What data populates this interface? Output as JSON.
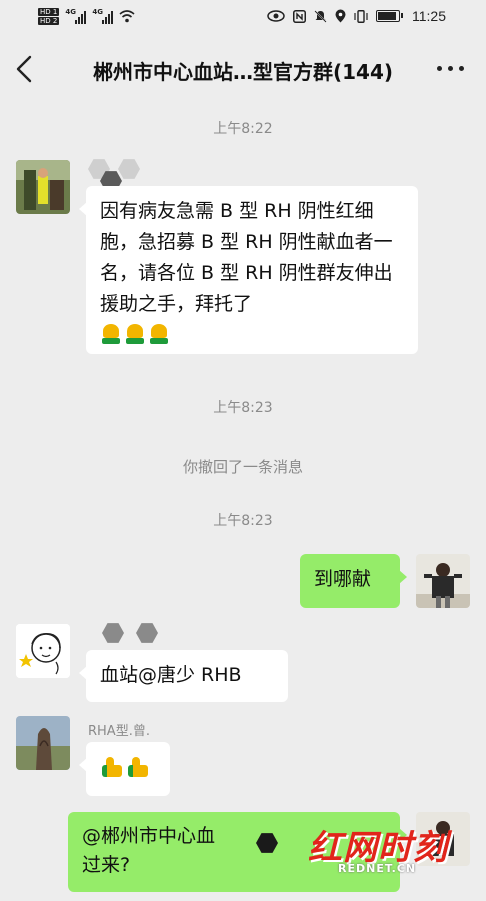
{
  "status_bar": {
    "time": "11:25",
    "network_1": "4G",
    "network_2": "4G",
    "hd_1": "HD 1",
    "hd_2": "HD 2"
  },
  "header": {
    "title": "郴州市中心血站…型官方群(144)",
    "back_icon": "chevron-left-icon",
    "more_icon": "more-dots-icon"
  },
  "messages": {
    "ts1": "上午8:22",
    "m1_text": "因有病友急需 B 型 RH 阴性红细胞，急招募 B 型 RH 阴性献血者一名，请各位 B 型 RH 阴性群友伸出援助之手，拜托了",
    "ts2": "上午8:23",
    "recall": "你撤回了一条消息",
    "ts3": "上午8:23",
    "m2_text": "到哪献",
    "m3_text": "血站@唐少 RHB",
    "m4_sender": "RHA型.曾.",
    "m5_text_line1": "@郴州市中心血",
    "m5_text_line2": "过来?"
  },
  "watermark": {
    "brand": "红网时刻",
    "url": "REDNET.CN"
  },
  "colors": {
    "background": "#ededed",
    "bubble_self": "#95ec69",
    "bubble_other": "#ffffff",
    "watermark": "#e1251b"
  }
}
